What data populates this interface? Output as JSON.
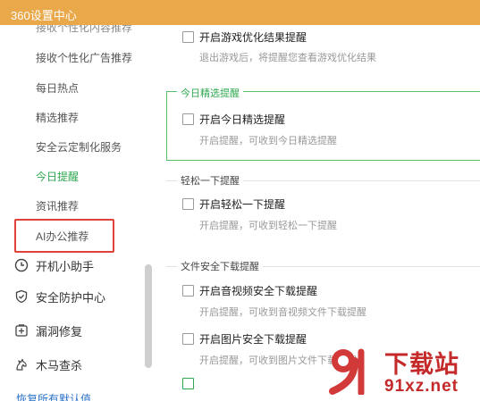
{
  "window": {
    "title": "360设置中心"
  },
  "sidebar": {
    "cut_item": "接收个性化内容推荐",
    "sub_items": [
      {
        "label": "接收个性化广告推荐"
      },
      {
        "label": "每日热点"
      },
      {
        "label": "精选推荐"
      },
      {
        "label": "安全云定制化服务"
      },
      {
        "label": "今日提醒",
        "active": true
      },
      {
        "label": "资讯推荐"
      },
      {
        "label": "AI办公推荐",
        "highlighted": true
      }
    ],
    "main_items": [
      {
        "label": "开机小助手",
        "icon": "clock-icon"
      },
      {
        "label": "安全防护中心",
        "icon": "shield-icon"
      },
      {
        "label": "漏洞修复",
        "icon": "plus-box-icon"
      },
      {
        "label": "木马查杀",
        "icon": "horse-icon"
      }
    ],
    "restore_link": "恢复所有默认值",
    "active_color": "#2fa84f",
    "highlight_color": "#e0413a"
  },
  "content": {
    "game_option": {
      "label": "开启游戏优化结果提醒",
      "desc": "退出游戏后，将提醒您查看游戏优化结果"
    },
    "groups": [
      {
        "title": "今日精选提醒",
        "options": [
          {
            "label": "开启今日精选提醒",
            "desc": "开启提醒，可收到今日精选提醒"
          }
        ]
      },
      {
        "title": "轻松一下提醒",
        "options": [
          {
            "label": "开启轻松一下提醒",
            "desc": "开启提醒，可收到轻松一下提醒"
          }
        ]
      },
      {
        "title": "文件安全下载提醒",
        "options": [
          {
            "label": "开启音视频安全下载提醒",
            "desc": "开启提醒，可收到音视频文件下载提醒"
          },
          {
            "label": "开启图片安全下载提醒",
            "desc": "开启提醒，可收到图片文件下载提醒"
          }
        ]
      }
    ]
  },
  "watermark": {
    "text": "下载站",
    "url": "91xz.net",
    "color": "#c42a2a"
  }
}
